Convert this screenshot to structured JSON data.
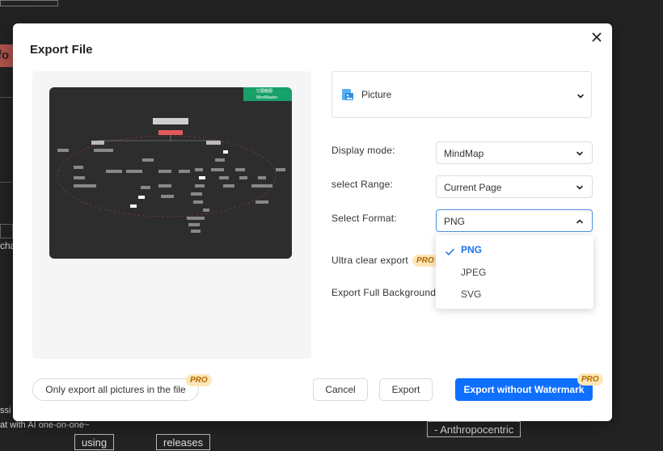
{
  "background": {
    "top_red_label": "fo",
    "left_labels": [
      "cha"
    ],
    "bottom_text_1": "ssi",
    "bottom_text_2": "at with AI one-on-one~",
    "nodes": [
      "- Anthropocentric",
      "using",
      "releases"
    ]
  },
  "dialog": {
    "title": "Export File",
    "close_icon": "close-icon"
  },
  "file_type": {
    "selected": "Picture",
    "icon": "picture-icon"
  },
  "display_mode": {
    "label": "Display mode:",
    "value": "MindMap"
  },
  "select_range": {
    "label": "select Range:",
    "value": "Current Page"
  },
  "select_format": {
    "label": "Select Format:",
    "value": "PNG",
    "options": [
      "PNG",
      "JPEG",
      "SVG"
    ],
    "selected_index": 0
  },
  "ultra_clear": {
    "label": "Ultra clear export",
    "badge": "PRO"
  },
  "full_background": {
    "label": "Export Full Background"
  },
  "preview": {
    "watermark_line1": "亿图脑图",
    "watermark_line2": "MindMaster"
  },
  "buttons": {
    "only_pictures": "Only export all pictures in the file",
    "only_pictures_badge": "PRO",
    "cancel": "Cancel",
    "export": "Export",
    "export_no_wm": "Export without Watermark",
    "export_no_wm_badge": "PRO"
  },
  "colors": {
    "primary": "#0f6fff",
    "pro_bg": "#fde7b8",
    "pro_text": "#b06a00",
    "watermark_green": "#18a06a"
  }
}
